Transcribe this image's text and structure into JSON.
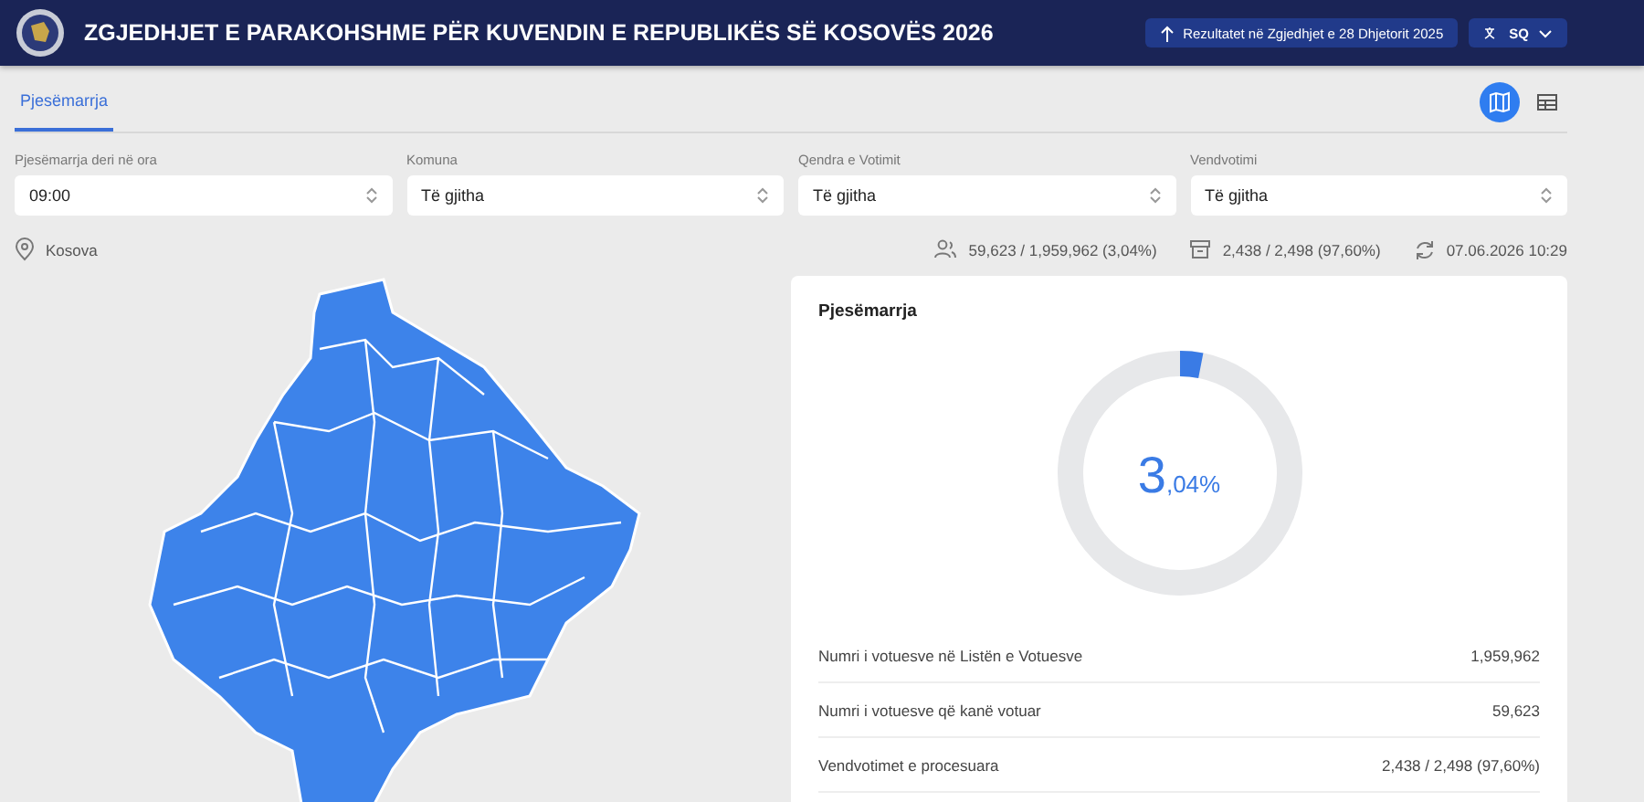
{
  "header": {
    "title": "ZGJEDHJET E PARAKOHSHME PËR KUVENDIN E REPUBLIKËS SË KOSOVËS 2026",
    "results_link": "Rezultatet në Zgjedhjet e 28 Dhjetorit 2025",
    "language": "SQ"
  },
  "tabs": [
    {
      "label": "Pjesëmarrja",
      "selected": true
    }
  ],
  "view_toggle": [
    {
      "kind": "map",
      "selected": true
    },
    {
      "kind": "table",
      "selected": false
    }
  ],
  "filters": [
    {
      "label": "Pjesëmarrja deri në ora",
      "value": "09:00"
    },
    {
      "label": "Komuna",
      "value": "Të gjitha"
    },
    {
      "label": "Qendra e Votimit",
      "value": "Të gjitha"
    },
    {
      "label": "Vendvotimi",
      "value": "Të gjitha"
    }
  ],
  "location": "Kosova",
  "stats": [
    {
      "kind": "voters",
      "text": "59,623 / 1,959,962 (3,04%)"
    },
    {
      "kind": "stations",
      "text": "2,438 / 2,498 (97,60%)"
    },
    {
      "kind": "updated",
      "text": "07.06.2026 10:29"
    }
  ],
  "turnout_card": {
    "title": "Pjesëmarrja",
    "level": 0.0304,
    "value_major": "3",
    "value_minor": ",04%",
    "rows": [
      {
        "label": "Numri i votuesve në Listën e Votuesve",
        "value": "1,959,962"
      },
      {
        "label": "Numri i votuesve që kanë votuar",
        "value": "59,623"
      },
      {
        "label": "Vendvotimet e procesuara",
        "value": "2,438 / 2,498 (97,60%)"
      }
    ]
  }
}
